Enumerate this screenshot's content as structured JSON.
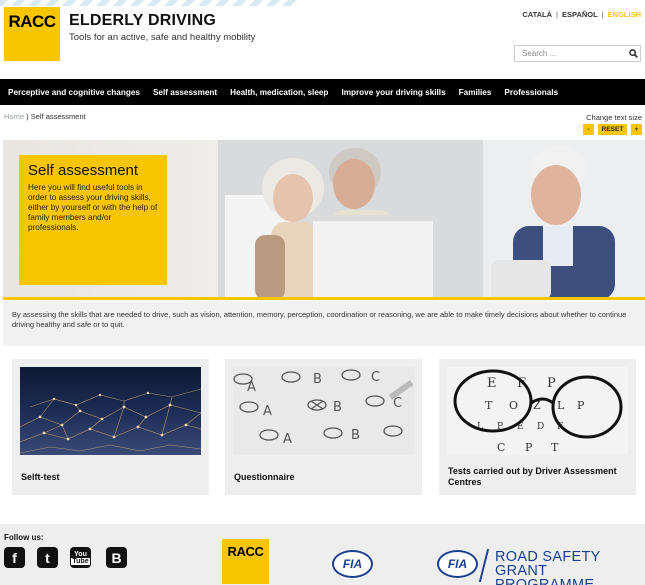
{
  "header": {
    "logo_text": "RACC",
    "title": "ELDERLY DRIVING",
    "subtitle": "Tools for an active, safe and healthy mobility",
    "languages": [
      "CATALÀ",
      "ESPAÑOL",
      "ENGLISH"
    ],
    "active_language": "ENGLISH",
    "search_placeholder": "Search ..."
  },
  "nav": {
    "items": [
      "Perceptive and cognitive changes",
      "Self assessment",
      "Health, medication, sleep",
      "Improve your driving skills",
      "Families",
      "Professionals"
    ]
  },
  "breadcrumb": {
    "home": "Home",
    "separator": ")",
    "current": "Self assessment"
  },
  "text_size": {
    "label": "Change text size",
    "minus": "-",
    "reset": "RESET",
    "plus": "+"
  },
  "hero": {
    "title": "Self assessment",
    "text": "Here you will find useful tools in order to assess your driving skills, either by yourself or with the help of family members and/or professionals."
  },
  "intro": "By assessing the skills that are needed to drive, such as vision, attention, memory, perception, coordination or reasoning, we are able to make timely decisions about whether to continue driving healthy and safe or to quit.",
  "cards": [
    {
      "label": "Selft-test"
    },
    {
      "label": "Questionnaire"
    },
    {
      "label": "Tests carried out by Driver Assessment Centres"
    }
  ],
  "footer": {
    "follow_label": "Follow us:",
    "social_icons": [
      "facebook-icon",
      "twitter-icon",
      "youtube-icon",
      "blog-icon"
    ],
    "racc_logo": "RACC",
    "fia_logo": "FIA",
    "road_safety_line1": "ROAD SAFETY",
    "road_safety_line2": "GRANT PROGRAMME"
  },
  "colors": {
    "accent": "#f7c600",
    "nav_bg": "#000000",
    "fia_blue": "#1b3f8f"
  }
}
